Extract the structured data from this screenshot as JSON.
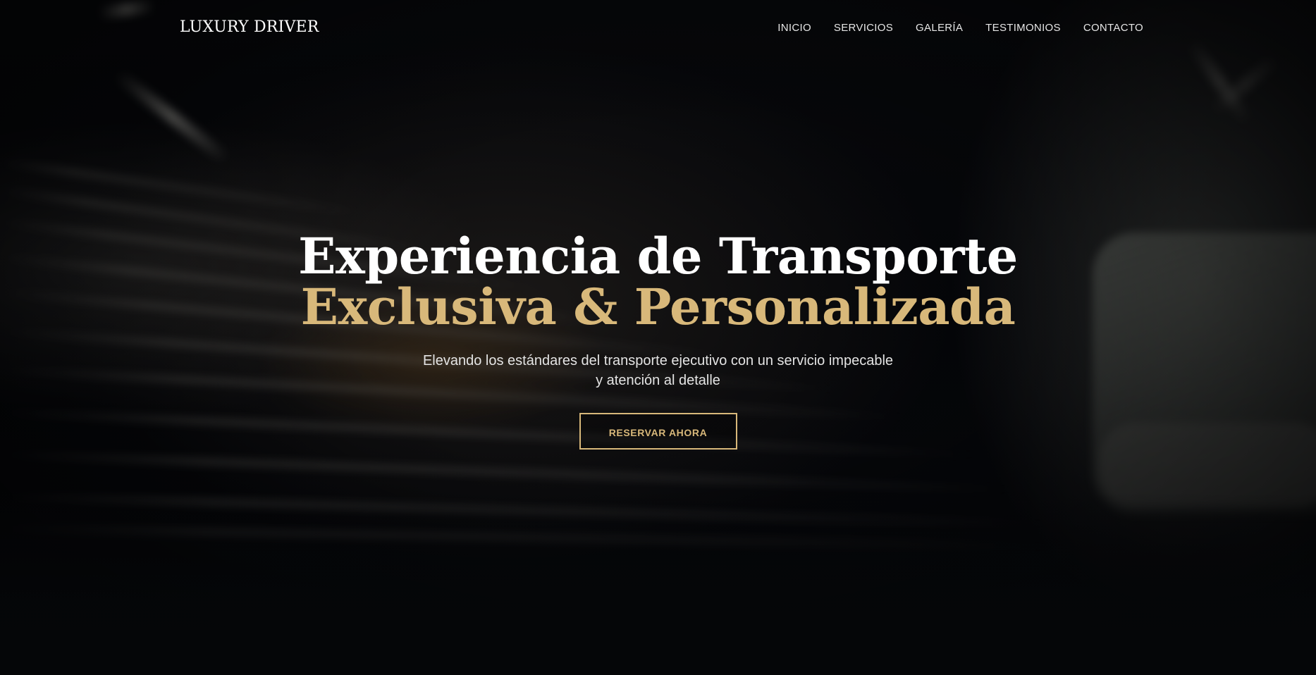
{
  "header": {
    "brand": "LUXURY DRIVER",
    "nav": [
      {
        "label": "INICIO"
      },
      {
        "label": "SERVICIOS"
      },
      {
        "label": "GALERÍA"
      },
      {
        "label": "TESTIMONIOS"
      },
      {
        "label": "CONTACTO"
      }
    ]
  },
  "hero": {
    "title_line1": "Experiencia de Transporte",
    "title_line2": "Exclusiva & Personalizada",
    "subtitle_line1": "Elevando los estándares del transporte ejecutivo con un servicio impecable",
    "subtitle_line2": "y atención al detalle",
    "cta_label": "RESERVAR AHORA"
  },
  "colors": {
    "accent": "#d8b87a",
    "background": "#050608",
    "text": "#ffffff"
  }
}
